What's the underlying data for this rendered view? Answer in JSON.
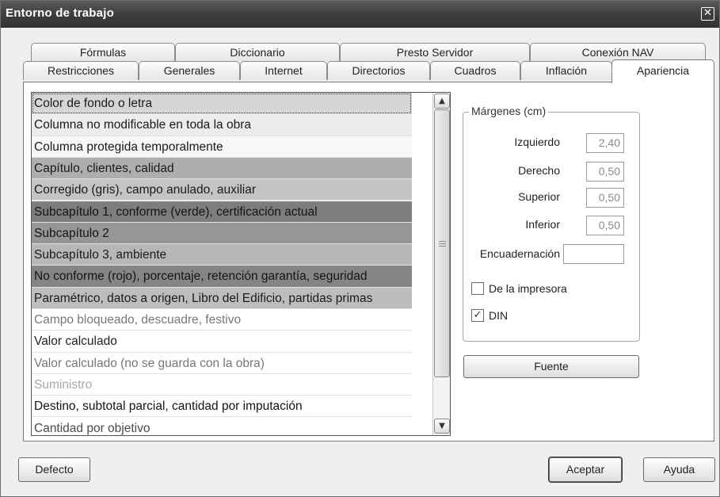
{
  "window": {
    "title": "Entorno de trabajo",
    "close_glyph": "✕"
  },
  "tabs_row1": [
    "Fórmulas",
    "Diccionario",
    "Presto Servidor",
    "Conexión NAV"
  ],
  "tabs_row2": [
    "Restricciones",
    "Generales",
    "Internet",
    "Directorios",
    "Cuadros",
    "Inflación",
    "Apariencia"
  ],
  "active_tab": "Apariencia",
  "color_list": {
    "items": [
      {
        "label": "Color de fondo o letra",
        "bg": "#d6d6d6",
        "fg": "#1a1a1a"
      },
      {
        "label": "Columna no modificable en toda la obra",
        "bg": "#ececec",
        "fg": "#1a1a1a"
      },
      {
        "label": "Columna protegida temporalmente",
        "bg": "#f7f7f7",
        "fg": "#1a1a1a"
      },
      {
        "label": "Capítulo, clientes, calidad",
        "bg": "#aeaeae",
        "fg": "#1a1a1a"
      },
      {
        "label": "Corregido (gris), campo anulado, auxiliar",
        "bg": "#c4c4c4",
        "fg": "#1a1a1a"
      },
      {
        "label": "Subcapítulo 1, conforme (verde), certificación actual",
        "bg": "#7d7d7d",
        "fg": "#141414"
      },
      {
        "label": "Subcapítulo 2",
        "bg": "#969696",
        "fg": "#141414"
      },
      {
        "label": "Subcapítulo 3, ambiente",
        "bg": "#b7b7b7",
        "fg": "#1a1a1a"
      },
      {
        "label": "No conforme (rojo), porcentaje, retención garantía, seguridad",
        "bg": "#858585",
        "fg": "#141414"
      },
      {
        "label": "Paramétrico, datos a origen, Libro del Edificio, partidas primas",
        "bg": "#bdbdbd",
        "fg": "#1a1a1a"
      },
      {
        "label": "Campo bloqueado, descuadre, festivo",
        "bg": "#ffffff",
        "fg": "#777777"
      },
      {
        "label": "Valor calculado",
        "bg": "#ffffff",
        "fg": "#1f1f1f"
      },
      {
        "label": "Valor calculado (no se guarda con la obra)",
        "bg": "#ffffff",
        "fg": "#767676"
      },
      {
        "label": "Suministro",
        "bg": "#ffffff",
        "fg": "#a8a8a8"
      },
      {
        "label": "Destino, subtotal parcial, cantidad por imputación",
        "bg": "#ffffff",
        "fg": "#141414"
      },
      {
        "label": "Cantidad por objetivo",
        "bg": "#ffffff",
        "fg": "#4a4a4a"
      }
    ],
    "selected_index": 0,
    "scroll_up_glyph": "▲",
    "scroll_down_glyph": "▼"
  },
  "margins": {
    "legend": "Márgenes (cm)",
    "izquierdo_label": "Izquierdo",
    "izquierdo_value": "2,40",
    "derecho_label": "Derecho",
    "derecho_value": "0,50",
    "superior_label": "Superior",
    "superior_value": "0,50",
    "inferior_label": "Inferior",
    "inferior_value": "0,50",
    "encuadernacion_label": "Encuadernación",
    "encuadernacion_value": ""
  },
  "checkboxes": {
    "de_la_impresora_label": "De la impresora",
    "de_la_impresora_checked": false,
    "din_label": "DIN",
    "din_checked": true,
    "check_glyph": "✓"
  },
  "buttons": {
    "fuente": "Fuente",
    "defecto": "Defecto",
    "aceptar": "Aceptar",
    "ayuda": "Ayuda"
  },
  "colors": {
    "titlebar": "#3c3c3c",
    "selected_tab": "#ffffff",
    "panel": "#ffffff"
  }
}
